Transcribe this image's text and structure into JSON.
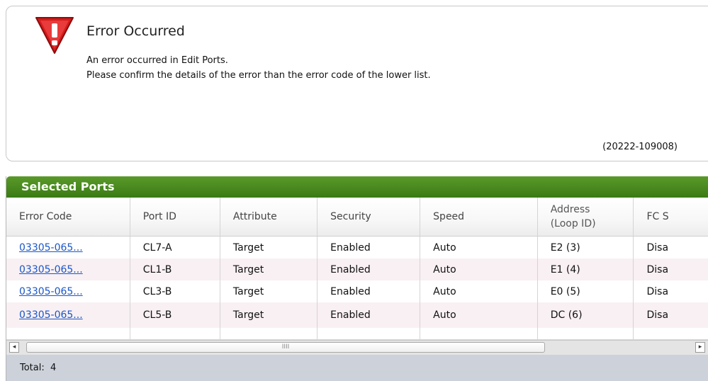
{
  "error": {
    "icon": "warning-triangle-icon",
    "title": "Error Occurred",
    "message_line1": "An error occurred in Edit Ports.",
    "message_line2": "Please confirm the details of the error than the error code of the lower list.",
    "code": "(20222-109008)"
  },
  "ports": {
    "title": "Selected Ports",
    "columns": [
      "Error Code",
      "Port ID",
      "Attribute",
      "Security",
      "Speed",
      "Address",
      "(Loop ID)",
      "FC S"
    ],
    "rows": [
      {
        "error_code": "03305-065...",
        "port_id": "CL7-A",
        "attribute": "Target",
        "security": "Enabled",
        "speed": "Auto",
        "address": "E2 (3)",
        "fc": "Disa"
      },
      {
        "error_code": "03305-065...",
        "port_id": "CL1-B",
        "attribute": "Target",
        "security": "Enabled",
        "speed": "Auto",
        "address": "E1 (4)",
        "fc": "Disa"
      },
      {
        "error_code": "03305-065...",
        "port_id": "CL3-B",
        "attribute": "Target",
        "security": "Enabled",
        "speed": "Auto",
        "address": "E0 (5)",
        "fc": "Disa"
      },
      {
        "error_code": "03305-065...",
        "port_id": "CL5-B",
        "attribute": "Target",
        "security": "Enabled",
        "speed": "Auto",
        "address": "DC (6)",
        "fc": "Disa"
      }
    ],
    "total_label": "Total:",
    "total_value": "4"
  },
  "scrollbar": {
    "left_arrow": "◂",
    "right_arrow": "▸",
    "grip": "IIII"
  },
  "colors": {
    "header_green": "#3a7a14",
    "link_blue": "#1a56c8",
    "footer_gray": "#ccd1da",
    "alt_row_pink": "#f9f0f3"
  }
}
